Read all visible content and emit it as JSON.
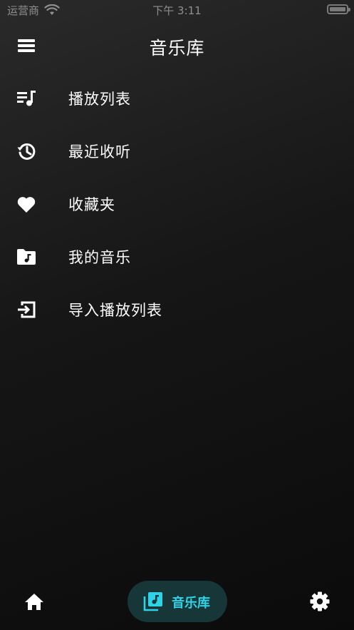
{
  "status_bar": {
    "carrier": "运营商",
    "time": "下午 3:11",
    "icons": [
      "wifi-icon",
      "battery-icon"
    ]
  },
  "header": {
    "title": "音乐库",
    "menu_icon": "hamburger-menu-icon"
  },
  "menu": {
    "items": [
      {
        "label": "播放列表",
        "icon": "playlist-icon"
      },
      {
        "label": "最近收听",
        "icon": "history-icon"
      },
      {
        "label": "收藏夹",
        "icon": "heart-icon"
      },
      {
        "label": "我的音乐",
        "icon": "music-folder-icon"
      },
      {
        "label": "导入播放列表",
        "icon": "import-icon"
      }
    ]
  },
  "bottom_nav": {
    "home_icon": "home-icon",
    "active_label": "音乐库",
    "active_icon": "music-library-icon",
    "settings_icon": "gear-icon"
  },
  "colors": {
    "accent": "#2fd3e8",
    "active_pill": "#163638",
    "text": "#ffffff",
    "background_top": "#2a2a2a",
    "background_bottom": "#0b0b0b"
  }
}
